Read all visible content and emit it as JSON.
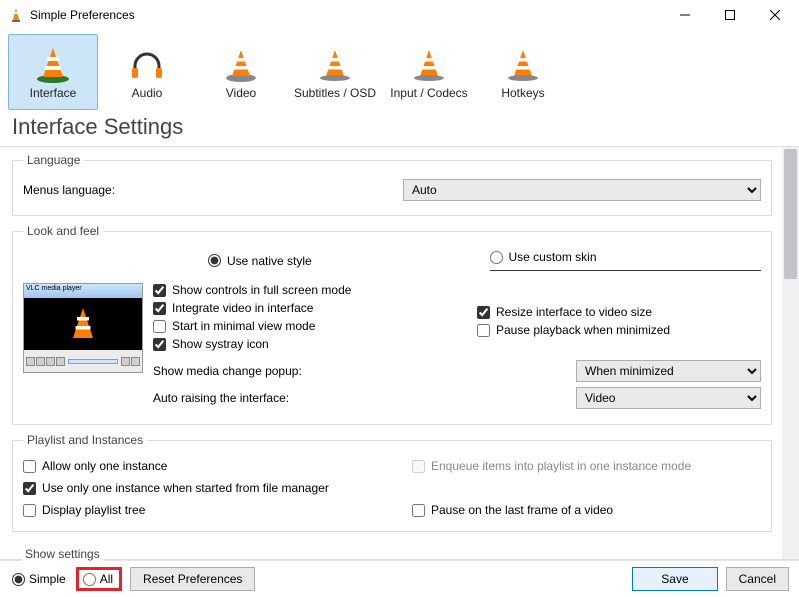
{
  "window": {
    "title": "Simple Preferences"
  },
  "tabs": [
    {
      "label": "Interface",
      "active": true
    },
    {
      "label": "Audio",
      "active": false
    },
    {
      "label": "Video",
      "active": false
    },
    {
      "label": "Subtitles / OSD",
      "active": false
    },
    {
      "label": "Input / Codecs",
      "active": false
    },
    {
      "label": "Hotkeys",
      "active": false
    }
  ],
  "heading": "Interface Settings",
  "language": {
    "legend": "Language",
    "menus_label": "Menus language:",
    "selected": "Auto"
  },
  "look": {
    "legend": "Look and feel",
    "radio_native": "Use native style",
    "radio_custom": "Use custom skin",
    "preview_title": "VLC media player",
    "chk_fullscreen": "Show controls in full screen mode",
    "chk_integrate": "Integrate video in interface",
    "chk_resize": "Resize interface to video size",
    "chk_minimal": "Start in minimal view mode",
    "chk_pause_min": "Pause playback when minimized",
    "chk_systray": "Show systray icon",
    "media_change_label": "Show media change popup:",
    "media_change_value": "When minimized",
    "auto_raise_label": "Auto raising the interface:",
    "auto_raise_value": "Video"
  },
  "playlist": {
    "legend": "Playlist and Instances",
    "chk_one_instance": "Allow only one instance",
    "chk_enqueue": "Enqueue items into playlist in one instance mode",
    "chk_filemgr": "Use only one instance when started from file manager",
    "chk_tree": "Display playlist tree",
    "chk_pause_last": "Pause on the last frame of a video"
  },
  "footer": {
    "show_settings": "Show settings",
    "simple": "Simple",
    "all": "All",
    "reset": "Reset Preferences",
    "save": "Save",
    "cancel": "Cancel"
  }
}
